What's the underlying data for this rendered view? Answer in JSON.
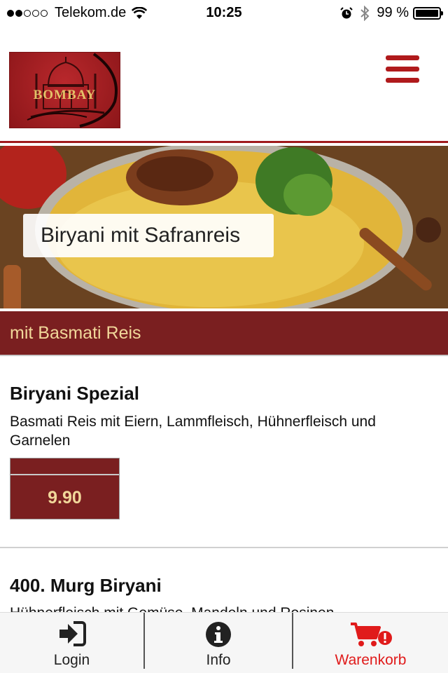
{
  "status_bar": {
    "carrier": "Telekom.de",
    "time": "10:25",
    "battery_text": "99 %",
    "signal_bars_filled": 2,
    "signal_bars_total": 5,
    "battery_level": 0.99
  },
  "header": {
    "logo_text": "BOMBAY",
    "menu_icon": "hamburger-menu-icon",
    "accent_color": "#a01a1d"
  },
  "hero": {
    "caption": "Biryani mit Safranreis"
  },
  "category": {
    "label": "mit Basmati Reis",
    "color": "#7a1f20"
  },
  "items": [
    {
      "title": "Biryani Spezial",
      "description": "Basmati Reis mit Eiern, Lammfleisch, Hühnerfleisch und Garnelen",
      "price": "9.90"
    },
    {
      "title": "400. Murg Biryani",
      "description": "Hühnerfleisch mit Gemüse, Mandeln und Rosinen"
    }
  ],
  "tabbar": {
    "tabs": [
      {
        "label": "Login",
        "icon": "login-icon",
        "color": "#222222"
      },
      {
        "label": "Info",
        "icon": "info-icon",
        "color": "#222222"
      },
      {
        "label": "Warenkorb",
        "icon": "shopping-cart-icon",
        "color": "#e01b1b"
      }
    ]
  }
}
